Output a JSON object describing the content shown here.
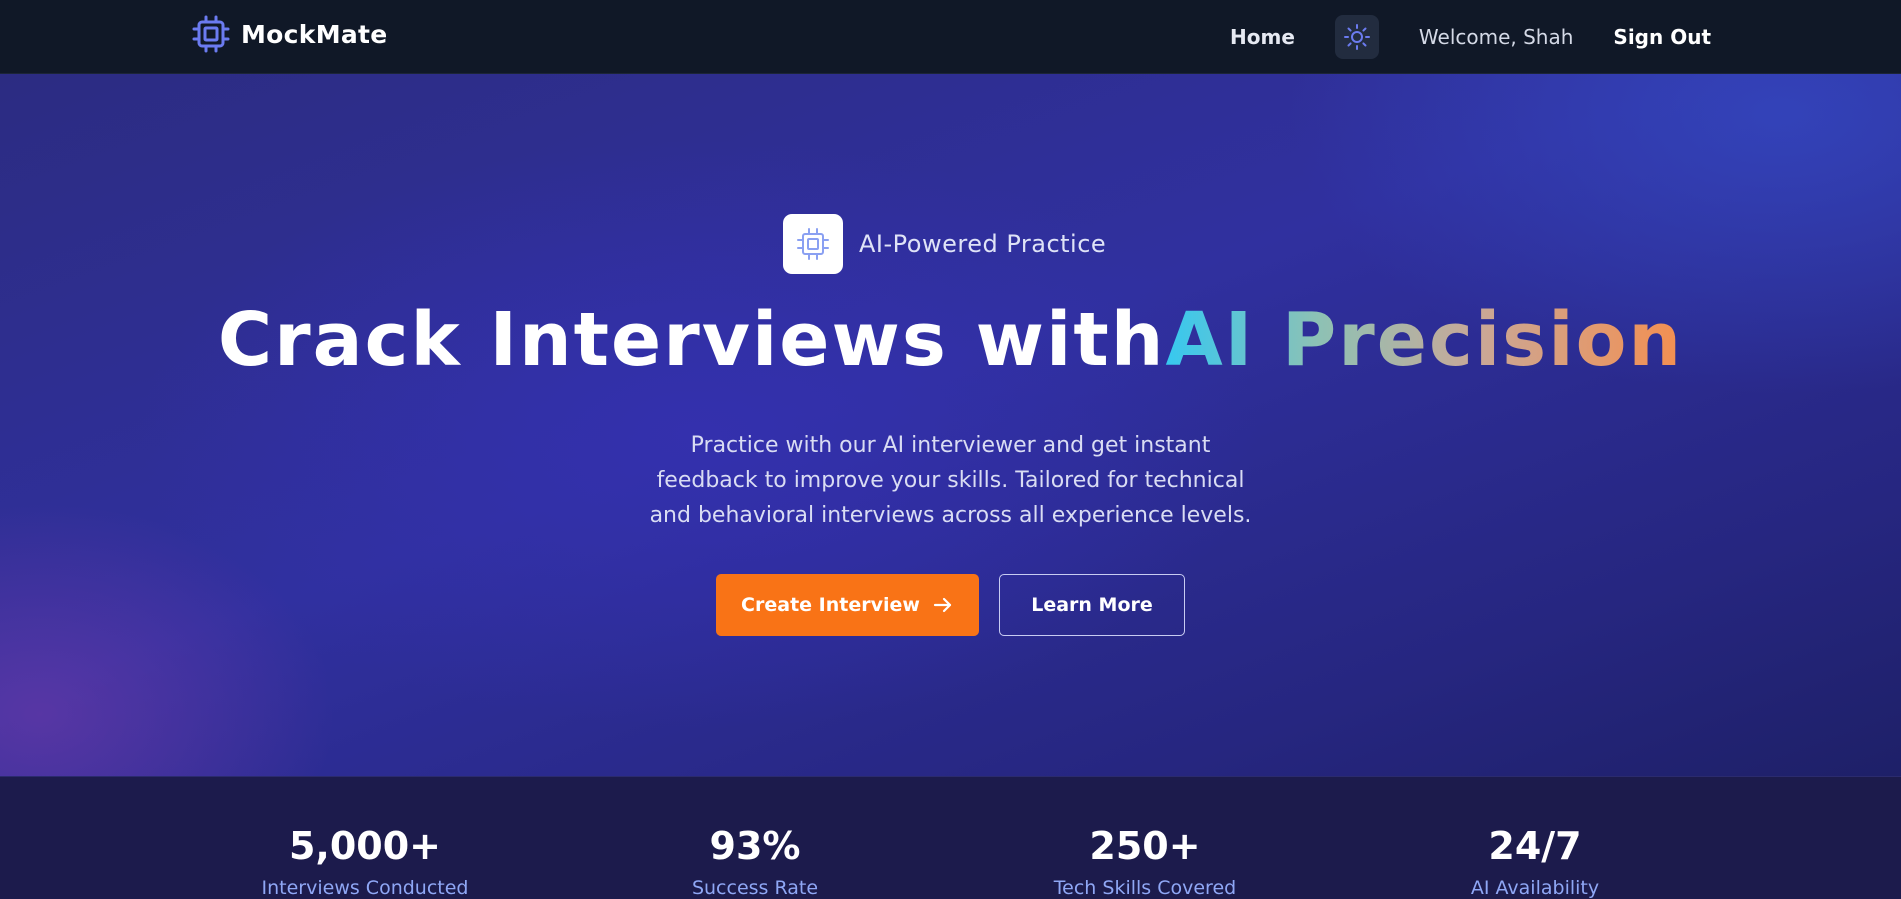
{
  "nav": {
    "brand": "MockMate",
    "brand_icon": "cpu-chip-icon",
    "home_label": "Home",
    "theme_icon": "sun-icon",
    "welcome_text": "Welcome, Shah",
    "signout_label": "Sign Out"
  },
  "hero": {
    "badge_icon": "cpu-chip-icon",
    "badge_text": "AI-Powered Practice",
    "headline_plain": "Crack Interviews with",
    "headline_highlight": "AI Precision",
    "subtitle": "Practice with our AI interviewer and get instant feedback to improve your skills. Tailored for technical and behavioral interviews across all experience levels.",
    "primary_cta": "Create Interview",
    "primary_cta_icon": "arrow-right-icon",
    "secondary_cta": "Learn More"
  },
  "stats": [
    {
      "value": "5,000+",
      "label": "Interviews Conducted"
    },
    {
      "value": "93%",
      "label": "Success Rate"
    },
    {
      "value": "250+",
      "label": "Tech Skills Covered"
    },
    {
      "value": "24/7",
      "label": "AI Availability"
    }
  ],
  "colors": {
    "nav_bg": "#101827",
    "accent_orange": "#f97316",
    "brand_icon": "#6b7bf0",
    "stats_bg": "#1c1b4c",
    "stat_label": "#8fa7f5"
  }
}
